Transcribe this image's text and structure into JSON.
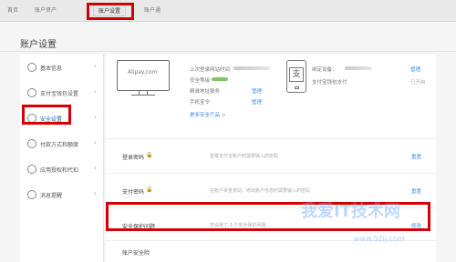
{
  "nav": {
    "tabs": [
      {
        "label": "首页"
      },
      {
        "label": "账户资产"
      },
      {
        "label": "账户设置"
      },
      {
        "label": "账户通"
      }
    ]
  },
  "page_title": "账户设置",
  "sidebar": {
    "items": [
      {
        "label": "基本信息",
        "icon": "user-icon"
      },
      {
        "label": "支付宝钱包设置",
        "icon": "wallet-icon"
      },
      {
        "label": "安全设置",
        "icon": "shield-icon"
      },
      {
        "label": "付款方式和额度",
        "icon": "card-icon"
      },
      {
        "label": "应用授权和代扣",
        "icon": "app-icon"
      },
      {
        "label": "消息提醒",
        "icon": "message-icon"
      }
    ]
  },
  "profile": {
    "device_brand": "Alipay.com",
    "last_login_label": "上次登录网站时间",
    "security_level_label": "安全等级:",
    "wisdom_service_label": "精准地址服务",
    "wisdom_service_action": "管理",
    "phone_label": "手机宝令",
    "phone_action": "管理",
    "more_products": "更多安全产品 >",
    "bound_device_label": "绑定设备：",
    "bound_device_action": "管理",
    "wallet_pay_label": "支付宝钱包支付",
    "wallet_pay_status": "已开启",
    "phone_glyph": "支"
  },
  "settings_rows": [
    {
      "name": "登录密码",
      "description": "登录支付宝账户时需要输入的密码",
      "action": "重置"
    },
    {
      "name": "支付密码",
      "description": "在账户资金变动、修改账户信息时需要输入的密码",
      "action": "重置"
    },
    {
      "name": "安全保护问题",
      "description": "您设置了 3 个安全保护问题",
      "action": "修改"
    },
    {
      "name": "账户安全险",
      "description": "",
      "action": ""
    }
  ],
  "watermark": {
    "main": "我爱IT技术网",
    "sub": "www.52ij.com"
  },
  "colors": {
    "accent": "#3a8ee6",
    "highlight": "#d40000"
  }
}
